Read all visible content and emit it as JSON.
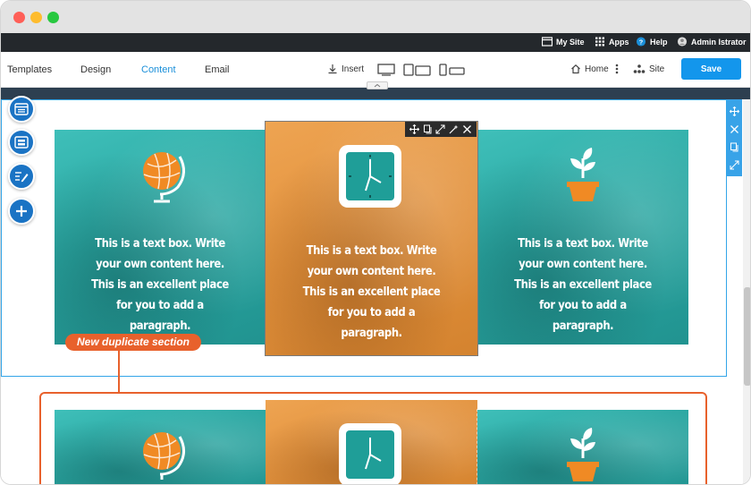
{
  "window": {
    "controls": [
      "close",
      "minimize",
      "maximize"
    ]
  },
  "admin_bar": {
    "my_site": "My Site",
    "apps": "Apps",
    "help": "Help",
    "user": "Admin Istrator"
  },
  "toolbar": {
    "tabs": [
      "Templates",
      "Design",
      "Content",
      "Email"
    ],
    "active_tab": "Content",
    "insert": "Insert",
    "devices": [
      "desktop-icon",
      "tablet-icon",
      "mobile-icon"
    ],
    "home": "Home",
    "site": "Site",
    "save": "Save"
  },
  "left_tools": [
    "layout-icon",
    "section-icon",
    "edit-text-icon",
    "add-icon"
  ],
  "card_toolbar_icons": [
    "move-icon",
    "copy-icon",
    "resize-icon",
    "magic-wand-icon",
    "close-icon"
  ],
  "side_panel_icons": [
    "move-icon",
    "close-icon",
    "copy-icon",
    "resize-icon"
  ],
  "cards": [
    {
      "icon": "globe-icon",
      "text": "This is a text box. Write your own content here. This is an excellent place for you to add a paragraph.",
      "color": "#2aa8a3"
    },
    {
      "icon": "clock-icon",
      "text": "This is a text box. Write your own content here. This is an excellent place for you to add a paragraph.",
      "color": "#e2913c"
    },
    {
      "icon": "plant-icon",
      "text": "This is a text box. Write your own content here. This is an excellent place for you to add a paragraph.",
      "color": "#2aa8a3"
    }
  ],
  "duplicate_label": "New duplicate section",
  "colors": {
    "accent": "#1396ec",
    "duplicate": "#e8612c",
    "teal": "#2aa8a3",
    "orange": "#e2913c"
  }
}
